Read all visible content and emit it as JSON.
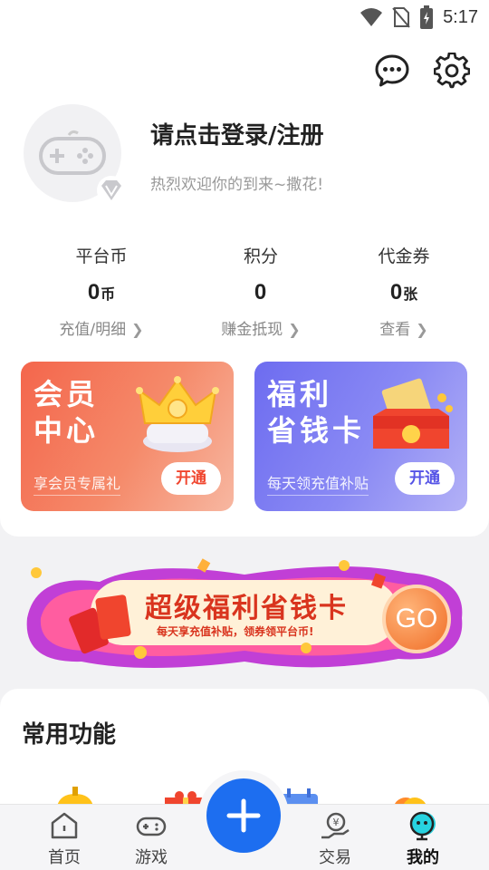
{
  "status_bar": {
    "time": "5:17",
    "icons": [
      "wifi-icon",
      "no-sim-icon",
      "battery-charging-icon"
    ]
  },
  "header": {
    "icons": [
      "chat-icon",
      "gear-icon"
    ]
  },
  "profile": {
    "title": "请点击登录/注册",
    "subtitle": "热烈欢迎你的到来~撒花!",
    "avatar_icon": "gamepad-icon",
    "badge_icon": "diamond-icon"
  },
  "stats": [
    {
      "label": "平台币",
      "value": "0",
      "unit": "币",
      "link": "充值/明细"
    },
    {
      "label": "积分",
      "value": "0",
      "unit": "",
      "link": "赚金抵现"
    },
    {
      "label": "代金券",
      "value": "0",
      "unit": "张",
      "link": "查看"
    }
  ],
  "promos": {
    "vip": {
      "title": "会员\n中心",
      "subtitle": "享会员专属礼",
      "button": "开通"
    },
    "save": {
      "title": "福利\n省钱卡",
      "subtitle": "每天领充值补贴",
      "button": "开通"
    }
  },
  "banner": {
    "title": "超级福利省钱卡",
    "subtitle": "每天享充值补贴，领券领平台币!",
    "go": "GO"
  },
  "functions": {
    "title": "常用功能"
  },
  "nav": {
    "items": [
      {
        "label": "首页",
        "icon": "home-icon"
      },
      {
        "label": "游戏",
        "icon": "gamepad-icon"
      },
      {
        "label": "交易",
        "icon": "trade-icon"
      },
      {
        "label": "我的",
        "icon": "profile-icon"
      }
    ],
    "fab_icon": "plus-icon"
  },
  "colors": {
    "accent": "#1d6ef0",
    "vip": "#f4664c",
    "save": "#6d6cf0"
  }
}
